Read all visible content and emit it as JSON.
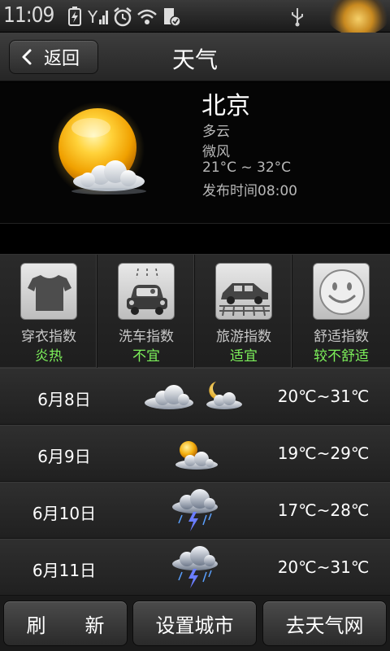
{
  "status_bar": {
    "time": "11:09",
    "icons": [
      "battery-charging-icon",
      "signal-icon",
      "alarm-icon",
      "wifi-icon",
      "sd-card-icon",
      "usb-icon"
    ]
  },
  "title_bar": {
    "back_label": "返回",
    "title": "天气"
  },
  "current": {
    "city": "北京",
    "condition": "多云",
    "wind": "微风",
    "temp_range": "21°C ~ 32°C",
    "publish_time": "发布时间08:00",
    "icon": "sun-cloud-icon"
  },
  "indices": [
    {
      "name": "穿衣指数",
      "value": "炎热",
      "icon": "tshirt-icon"
    },
    {
      "name": "洗车指数",
      "value": "不宜",
      "icon": "car-wash-icon"
    },
    {
      "name": "旅游指数",
      "value": "适宜",
      "icon": "travel-car-icon"
    },
    {
      "name": "舒适指数",
      "value": "较不舒适",
      "icon": "smiley-icon"
    }
  ],
  "forecast": [
    {
      "date": "6月8日",
      "temp": "20℃~31℃",
      "icon": "cloudy-to-partly-cloudy-night-icon"
    },
    {
      "date": "6月9日",
      "temp": "19℃~29℃",
      "icon": "partly-cloudy-icon"
    },
    {
      "date": "6月10日",
      "temp": "17℃~28℃",
      "icon": "thunderstorm-icon"
    },
    {
      "date": "6月11日",
      "temp": "20℃~31℃",
      "icon": "thunderstorm-icon"
    }
  ],
  "bottom_buttons": {
    "refresh": "刷　　新",
    "set_city": "设置城市",
    "go_weather_site": "去天气网"
  },
  "colors": {
    "index_value_green": "#7cf05a",
    "background": "#000000"
  }
}
